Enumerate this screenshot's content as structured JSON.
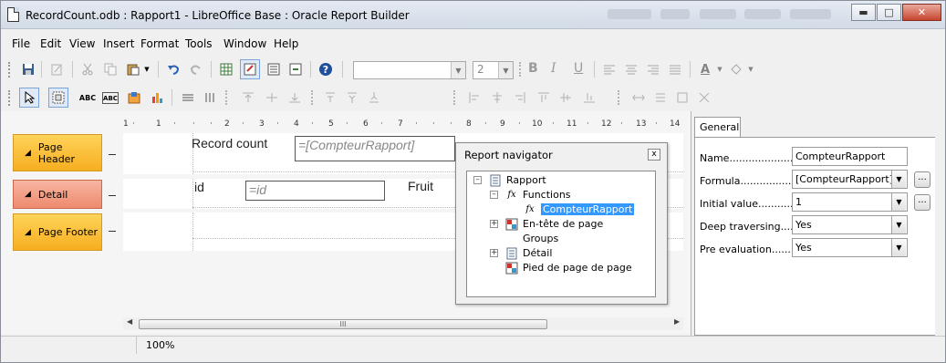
{
  "window": {
    "title": "RecordCount.odb : Rapport1 - LibreOffice Base : Oracle Report Builder"
  },
  "menu": [
    "File",
    "Edit",
    "View",
    "Insert",
    "Format",
    "Tools",
    "Window",
    "Help"
  ],
  "toolbar": {
    "font_name": "",
    "font_size": "2"
  },
  "ruler": [
    "1",
    "1",
    "2",
    "3",
    "4",
    "5",
    "6",
    "7",
    "8",
    "9",
    "10",
    "11",
    "12",
    "13",
    "14"
  ],
  "sections": {
    "page_header": "Page Header",
    "detail": "Detail",
    "page_footer": "Page Footer"
  },
  "report": {
    "record_count_label": "Record count",
    "record_count_field": "=[CompteurRapport]",
    "id_label": "id",
    "id_field": "=id",
    "fruit_label": "Fruit"
  },
  "navigator": {
    "title": "Report navigator",
    "close": "x",
    "tree": {
      "root": "Rapport",
      "functions": "Functions",
      "compteur": "CompteurRapport",
      "entete": "En-tête de page",
      "groups": "Groups",
      "detail": "Détail",
      "pied": "Pied de page de page"
    }
  },
  "properties": {
    "tab": "General",
    "name_label": "Name......................",
    "name_value": "CompteurRapport",
    "formula_label": "Formula..................",
    "formula_value": "[CompteurRapport]",
    "initial_label": "Initial value............",
    "initial_value": "1",
    "deep_label": "Deep traversing.....",
    "deep_value": "Yes",
    "pre_label": "Pre evaluation.........",
    "pre_value": "Yes",
    "dots": "..."
  },
  "status": {
    "zoom": "100%"
  },
  "scrollbar": {
    "grip": "III"
  }
}
